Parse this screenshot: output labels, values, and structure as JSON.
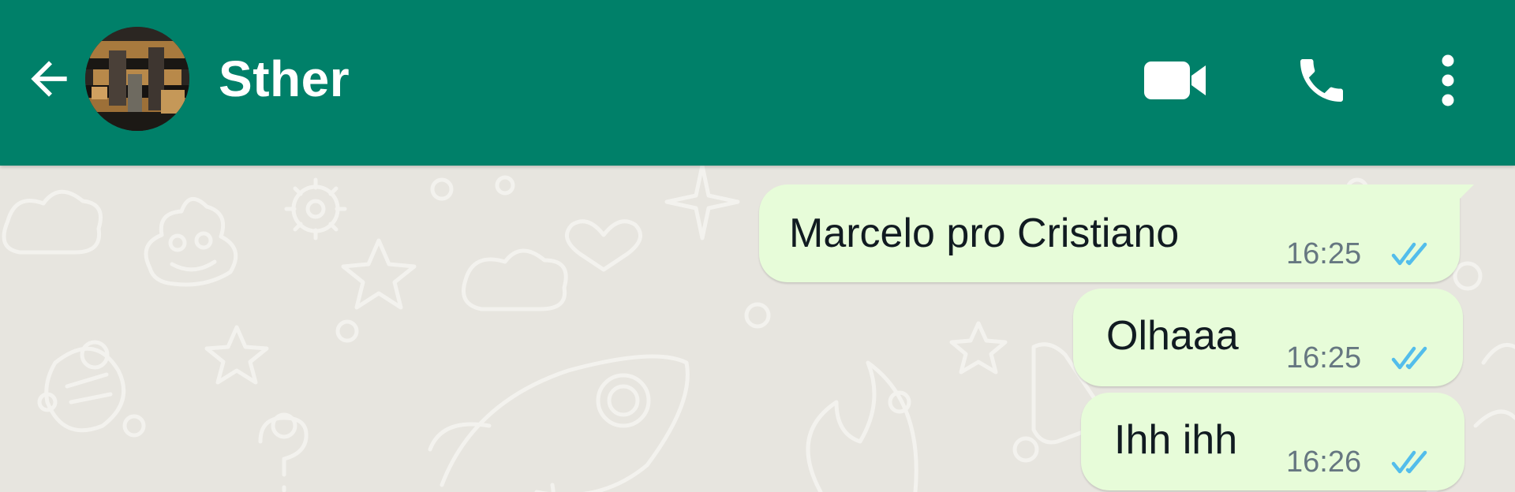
{
  "header": {
    "contact_name": "Sther",
    "background_color": "#008069",
    "icons": {
      "back": "arrow-left-icon",
      "video": "video-camera-icon",
      "call": "phone-icon",
      "menu": "more-vertical-icon"
    }
  },
  "chat": {
    "bubble_color": "#e7fcd9",
    "read_tick_color": "#53bdeb",
    "messages": [
      {
        "text": "Marcelo pro Cristiano",
        "time": "16:25",
        "status": "read",
        "direction": "outgoing"
      },
      {
        "text": "Olhaaa",
        "time": "16:25",
        "status": "read",
        "direction": "outgoing"
      },
      {
        "text": "Ihh ihh",
        "time": "16:26",
        "status": "read",
        "direction": "outgoing"
      }
    ]
  }
}
